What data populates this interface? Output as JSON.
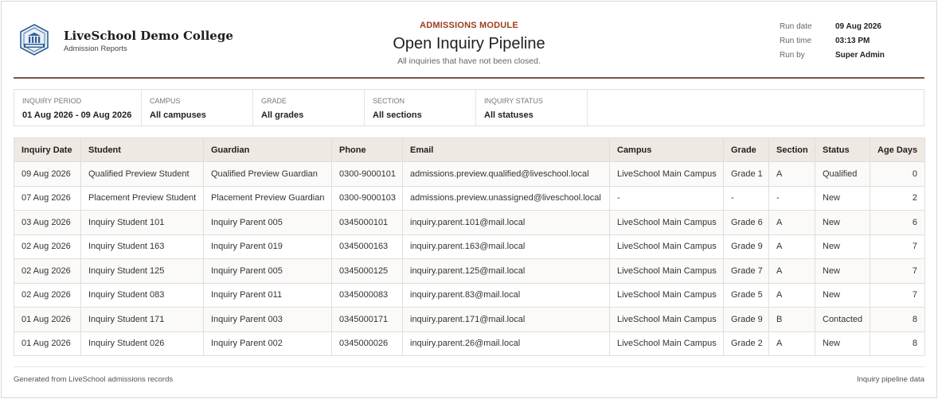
{
  "brand": {
    "name": "LiveSchool Demo College",
    "subtitle": "Admission Reports",
    "logo_icon": "school-crest-icon"
  },
  "header": {
    "module": "ADMISSIONS MODULE",
    "title": "Open Inquiry Pipeline",
    "subtitle": "All inquiries that have not been closed."
  },
  "run_info": [
    {
      "label": "Run date",
      "value": "09 Aug 2026"
    },
    {
      "label": "Run time",
      "value": "03:13 PM"
    },
    {
      "label": "Run by",
      "value": "Super Admin"
    }
  ],
  "filters": [
    {
      "label": "INQUIRY PERIOD",
      "value": "01 Aug 2026 - 09 Aug 2026"
    },
    {
      "label": "CAMPUS",
      "value": "All campuses"
    },
    {
      "label": "GRADE",
      "value": "All grades"
    },
    {
      "label": "SECTION",
      "value": "All sections"
    },
    {
      "label": "INQUIRY STATUS",
      "value": "All statuses"
    }
  ],
  "table": {
    "columns": [
      "Inquiry Date",
      "Student",
      "Guardian",
      "Phone",
      "Email",
      "Campus",
      "Grade",
      "Section",
      "Status",
      "Age Days"
    ],
    "rows": [
      [
        "09 Aug 2026",
        "Qualified Preview Student",
        "Qualified Preview Guardian",
        "0300-9000101",
        "admissions.preview.qualified@liveschool.local",
        "LiveSchool Main Campus",
        "Grade 1",
        "A",
        "Qualified",
        "0"
      ],
      [
        "07 Aug 2026",
        "Placement Preview Student",
        "Placement Preview Guardian",
        "0300-9000103",
        "admissions.preview.unassigned@liveschool.local",
        "-",
        "-",
        "-",
        "New",
        "2"
      ],
      [
        "03 Aug 2026",
        "Inquiry Student 101",
        "Inquiry Parent 005",
        "0345000101",
        "inquiry.parent.101@mail.local",
        "LiveSchool Main Campus",
        "Grade 6",
        "A",
        "New",
        "6"
      ],
      [
        "02 Aug 2026",
        "Inquiry Student 163",
        "Inquiry Parent 019",
        "0345000163",
        "inquiry.parent.163@mail.local",
        "LiveSchool Main Campus",
        "Grade 9",
        "A",
        "New",
        "7"
      ],
      [
        "02 Aug 2026",
        "Inquiry Student 125",
        "Inquiry Parent 005",
        "0345000125",
        "inquiry.parent.125@mail.local",
        "LiveSchool Main Campus",
        "Grade 7",
        "A",
        "New",
        "7"
      ],
      [
        "02 Aug 2026",
        "Inquiry Student 083",
        "Inquiry Parent 011",
        "0345000083",
        "inquiry.parent.83@mail.local",
        "LiveSchool Main Campus",
        "Grade 5",
        "A",
        "New",
        "7"
      ],
      [
        "01 Aug 2026",
        "Inquiry Student 171",
        "Inquiry Parent 003",
        "0345000171",
        "inquiry.parent.171@mail.local",
        "LiveSchool Main Campus",
        "Grade 9",
        "B",
        "Contacted",
        "8"
      ],
      [
        "01 Aug 2026",
        "Inquiry Student 026",
        "Inquiry Parent 002",
        "0345000026",
        "inquiry.parent.26@mail.local",
        "LiveSchool Main Campus",
        "Grade 2",
        "A",
        "New",
        "8"
      ]
    ]
  },
  "footer": {
    "left": "Generated from LiveSchool admissions records",
    "right": "Inquiry pipeline data"
  },
  "colors": {
    "accent": "#9a3e1c",
    "rule": "#7a5744",
    "header_bg": "#efe9e3"
  }
}
